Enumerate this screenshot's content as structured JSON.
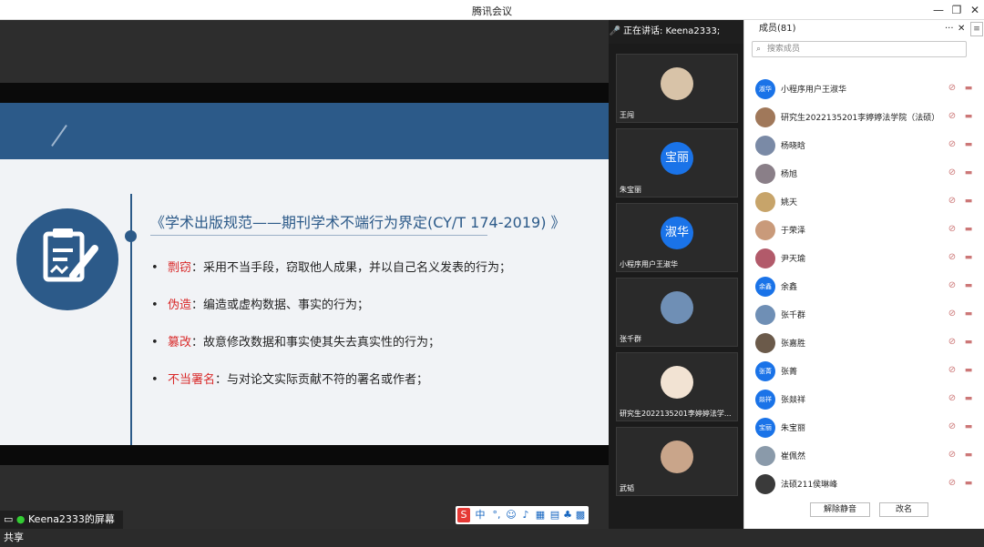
{
  "window": {
    "title": "腾讯会议"
  },
  "slide": {
    "title": "《学术出版规范——期刊学术不端行为界定(CY/T 174-2019) 》",
    "bullets": [
      {
        "key": "剽窃",
        "text": "：采用不当手段，窃取他人成果，并以自己名义发表的行为；"
      },
      {
        "key": "伪造",
        "text": "：编造或虚构数据、事实的行为；"
      },
      {
        "key": "篡改",
        "text": "：故意修改数据和事实使其失去真实性的行为；"
      },
      {
        "key": "不当署名",
        "text": "：与对论文实际贡献不符的署名或作者；"
      }
    ]
  },
  "status": {
    "share_text": "Keena2333的屏幕共享"
  },
  "speaking": {
    "text": "正在讲话: Keena2333;"
  },
  "video_tiles": [
    {
      "name": "王闯",
      "avatar": "photo"
    },
    {
      "name": "朱宝丽",
      "avatar": "宝丽"
    },
    {
      "name": "小程序用户王淑华",
      "avatar": "淑华"
    },
    {
      "name": "张千群",
      "avatar": "photo"
    },
    {
      "name": "研究生2022135201李婷婷法学...",
      "avatar": "photo"
    },
    {
      "name": "武韬",
      "avatar": "photo"
    }
  ],
  "panel": {
    "header": "成员(81)",
    "search_placeholder": "搜索成员",
    "members": [
      {
        "name": "小程序用户王淑华",
        "avatar": "淑华",
        "color": "#1a73e8"
      },
      {
        "name": "研究生2022135201李婷婷法学院（法硕）",
        "avatar": "",
        "color": "#a0785a"
      },
      {
        "name": "杨晓晗",
        "avatar": "",
        "color": "#7a8aa6"
      },
      {
        "name": "杨旭",
        "avatar": "",
        "color": "#8a7f88"
      },
      {
        "name": "姚天",
        "avatar": "",
        "color": "#c7a46a"
      },
      {
        "name": "于荣泽",
        "avatar": "",
        "color": "#c99a7a"
      },
      {
        "name": "尹天瑜",
        "avatar": "",
        "color": "#b25a6a"
      },
      {
        "name": "余鑫",
        "avatar": "余鑫",
        "color": "#1a73e8"
      },
      {
        "name": "张千群",
        "avatar": "",
        "color": "#6f8fb5"
      },
      {
        "name": "张嘉胜",
        "avatar": "",
        "color": "#6b5a4a"
      },
      {
        "name": "张菁",
        "avatar": "张菁",
        "color": "#1a73e8"
      },
      {
        "name": "张燚祥",
        "avatar": "燚祥",
        "color": "#1a73e8"
      },
      {
        "name": "朱宝丽",
        "avatar": "宝丽",
        "color": "#1a73e8"
      },
      {
        "name": "崔佩然",
        "avatar": "",
        "color": "#8a9aaa"
      },
      {
        "name": "法硕211侯琳峰",
        "avatar": "",
        "color": "#3a3a3a"
      }
    ],
    "unmute_all": "解除静音",
    "rename": "改名"
  }
}
